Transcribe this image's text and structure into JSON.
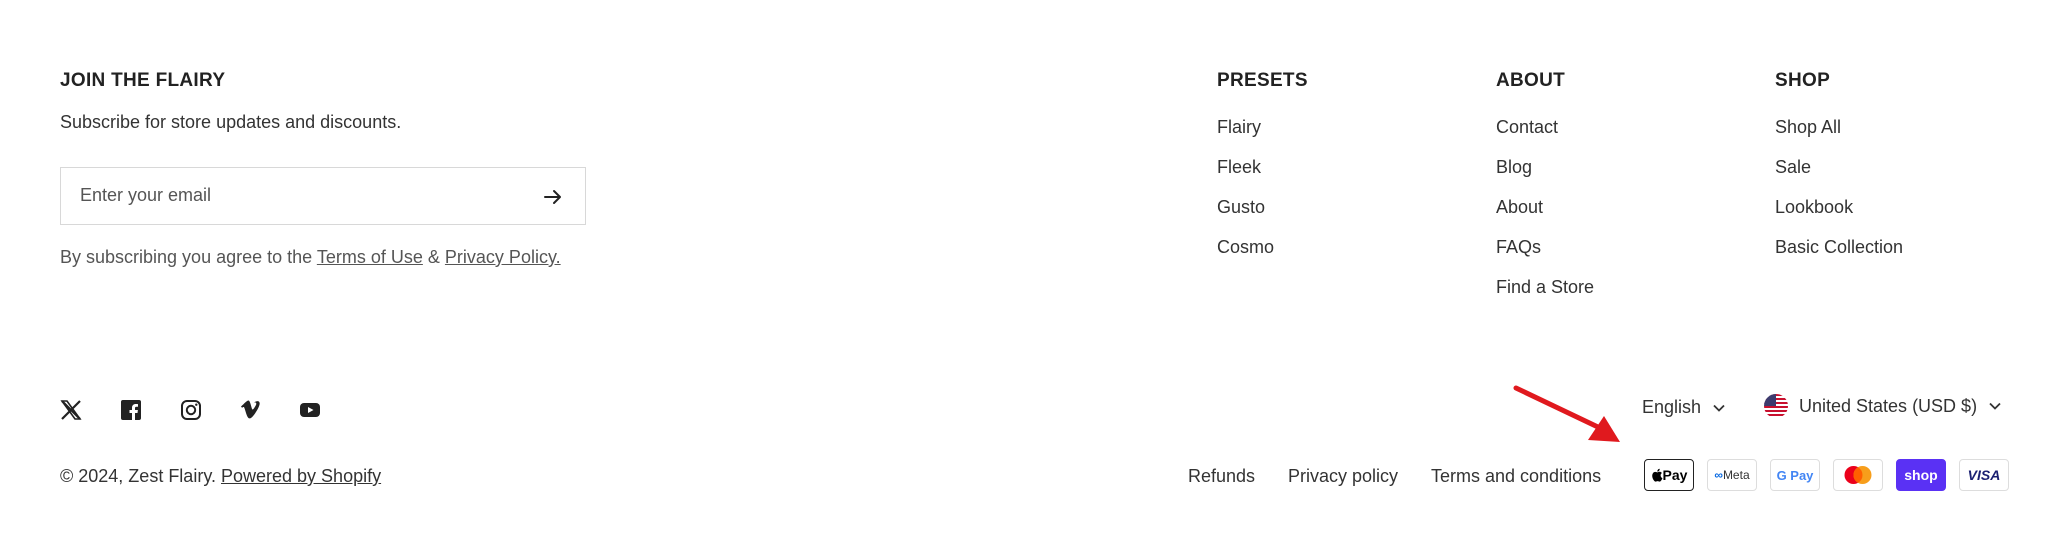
{
  "newsletter": {
    "title": "JOIN THE FLAIRY",
    "subtitle": "Subscribe for store updates and discounts.",
    "email_placeholder": "Enter your email",
    "legal_prefix": "By subscribing you agree to the",
    "terms_label": "Terms of Use",
    "ampersand": "&",
    "privacy_label": "Privacy Policy."
  },
  "columns": [
    {
      "title": "PRESETS",
      "links": [
        "Flairy",
        "Fleek",
        "Gusto",
        "Cosmo"
      ]
    },
    {
      "title": "ABOUT",
      "links": [
        "Contact",
        "Blog",
        "About",
        "FAQs",
        "Find a Store"
      ]
    },
    {
      "title": "SHOP",
      "links": [
        "Shop All",
        "Sale",
        "Lookbook",
        "Basic Collection"
      ]
    }
  ],
  "social": [
    "x-icon",
    "facebook-icon",
    "instagram-icon",
    "vimeo-icon",
    "youtube-icon"
  ],
  "locale": {
    "language": "English",
    "country": "United States (USD $)",
    "flag": "us-flag-icon"
  },
  "copyright": {
    "text": "© 2024, Zest Flairy.",
    "powered": "Powered by Shopify"
  },
  "policies": [
    "Refunds",
    "Privacy policy",
    "Terms and conditions"
  ],
  "payments": [
    {
      "name": "Apple Pay",
      "label": "Pay"
    },
    {
      "name": "Meta Pay",
      "label": "Meta"
    },
    {
      "name": "Google Pay",
      "label": "G Pay"
    },
    {
      "name": "Mastercard",
      "label": ""
    },
    {
      "name": "Shop Pay",
      "label": "shop"
    },
    {
      "name": "Visa",
      "label": "VISA"
    }
  ],
  "colors": {
    "shop_pay": "#5a31f4",
    "visa": "#1a1f71",
    "mastercard_red": "#eb001b",
    "mastercard_orange": "#f79e1b",
    "annotation_arrow": "#e0191e"
  }
}
